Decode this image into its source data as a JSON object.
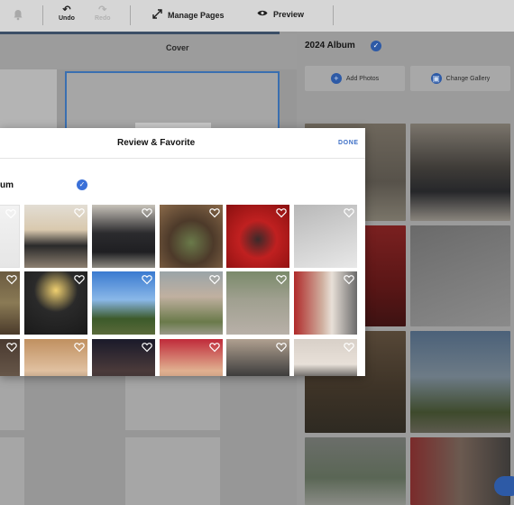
{
  "toolbar": {
    "undo_label": "Undo",
    "redo_label": "Redo",
    "manage_pages_label": "Manage Pages",
    "preview_label": "Preview"
  },
  "canvas": {
    "cover_label": "Cover"
  },
  "gallery_panel": {
    "album_title": "2024 Album",
    "add_photos_label": "Add Photos",
    "change_gallery_label": "Change Gallery"
  },
  "modal": {
    "title": "Review & Favorite",
    "done_label": "DONE",
    "album_row_label": "um",
    "photos": [
      {
        "label": "blank"
      },
      {
        "label": "two women"
      },
      {
        "label": "bridesmaids"
      },
      {
        "label": "table food"
      },
      {
        "label": "red room selfie"
      },
      {
        "label": "feet & bag"
      },
      {
        "label": "jacket"
      },
      {
        "label": "night lights friends"
      },
      {
        "label": "sky trees"
      },
      {
        "label": "couple hug"
      },
      {
        "label": "patio"
      },
      {
        "label": "couple kiss"
      },
      {
        "label": "cuff"
      },
      {
        "label": "sunglasses"
      },
      {
        "label": "group night"
      },
      {
        "label": "sunglasses pair"
      },
      {
        "label": "dog"
      },
      {
        "label": "dog on couch"
      }
    ]
  },
  "colors": {
    "accent": "#3a70d8",
    "done": "#3d6fc6",
    "overlay": "#9a9a9a"
  },
  "icons": [
    "bell-icon",
    "undo-icon",
    "redo-icon",
    "expand-icon",
    "eye-icon",
    "check-icon",
    "plus-icon",
    "gallery-icon",
    "heart-icon"
  ]
}
